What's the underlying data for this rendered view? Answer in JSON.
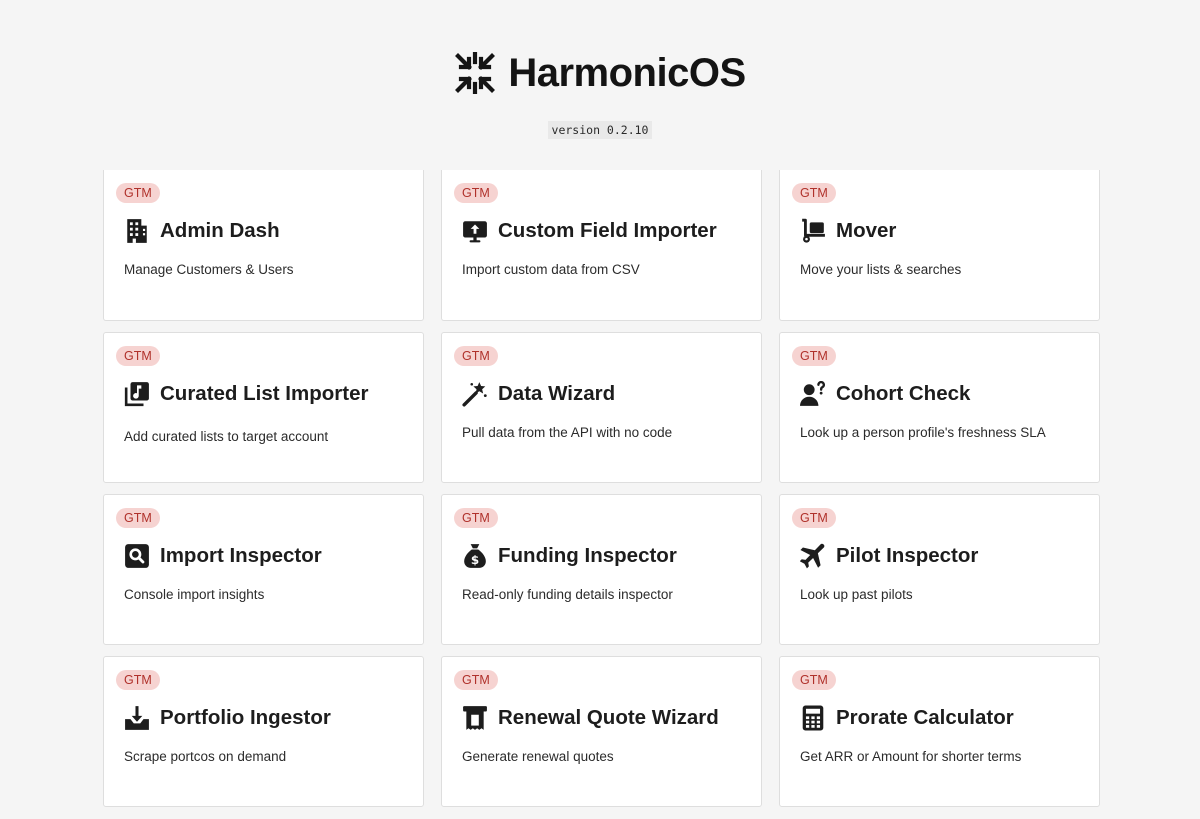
{
  "app": {
    "name": "HarmonicOS",
    "version": "version 0.2.10",
    "logo_icon": "harmonic-logo-icon"
  },
  "tools": [
    {
      "tag": "GTM",
      "icon": "office-building-icon",
      "title": "Admin Dash",
      "description": "Manage Customers & Users"
    },
    {
      "tag": "GTM",
      "icon": "monitor-upload-icon",
      "title": "Custom Field Importer",
      "description": "Import custom data from CSV"
    },
    {
      "tag": "GTM",
      "icon": "hand-truck-icon",
      "title": "Mover",
      "description": "Move your lists & searches"
    },
    {
      "tag": "GTM",
      "icon": "music-library-icon",
      "title": "Curated List Importer",
      "description": "Add curated lists to target account"
    },
    {
      "tag": "GTM",
      "icon": "magic-wand-icon",
      "title": "Data Wizard",
      "description": "Pull data from the API with no code"
    },
    {
      "tag": "GTM",
      "icon": "person-question-icon",
      "title": "Cohort Check",
      "description": "Look up a person profile's freshness SLA"
    },
    {
      "tag": "GTM",
      "icon": "search-box-icon",
      "title": "Import Inspector",
      "description": "Console import insights"
    },
    {
      "tag": "GTM",
      "icon": "money-bag-icon",
      "title": "Funding Inspector",
      "description": "Read-only funding details inspector"
    },
    {
      "tag": "GTM",
      "icon": "airplane-icon",
      "title": "Pilot Inspector",
      "description": "Look up past pilots"
    },
    {
      "tag": "GTM",
      "icon": "tray-download-icon",
      "title": "Portfolio Ingestor",
      "description": "Scrape portcos on demand"
    },
    {
      "tag": "GTM",
      "icon": "receipt-icon",
      "title": "Renewal Quote Wizard",
      "description": "Generate renewal quotes"
    },
    {
      "tag": "GTM",
      "icon": "calculator-icon",
      "title": "Prorate Calculator",
      "description": "Get ARR or Amount for shorter terms"
    }
  ],
  "colors": {
    "background": "#f5f5f5",
    "card": "#ffffff",
    "tag_bg": "#f6d3d1",
    "tag_text": "#b0312b",
    "text": "#1d1d1d"
  }
}
